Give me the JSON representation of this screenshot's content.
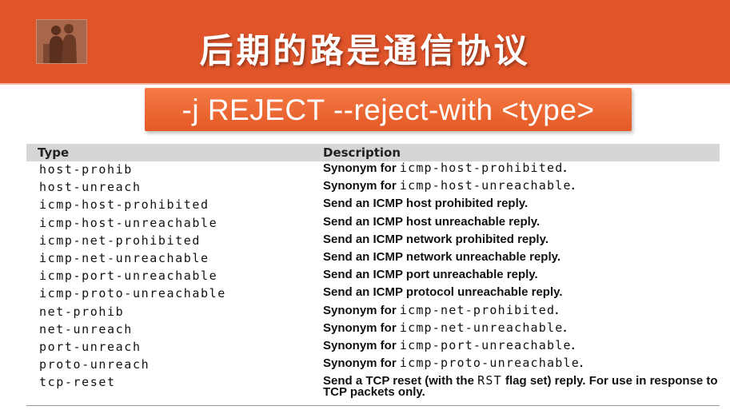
{
  "slide": {
    "title": "后期的路是通信协议",
    "command": "-j REJECT --reject-with <type>"
  },
  "table": {
    "headers": {
      "type": "Type",
      "description": "Description"
    },
    "rows": [
      {
        "type": "host-prohib",
        "desc_text": "Synonym for ",
        "desc_code": "icmp-host-prohibited",
        "desc_end": "."
      },
      {
        "type": "host-unreach",
        "desc_text": "Synonym for ",
        "desc_code": "icmp-host-unreachable",
        "desc_end": "."
      },
      {
        "type": "icmp-host-prohibited",
        "desc_text": "Send an ICMP host prohibited reply.",
        "desc_code": "",
        "desc_end": ""
      },
      {
        "type": "icmp-host-unreachable",
        "desc_text": "Send an ICMP host unreachable reply.",
        "desc_code": "",
        "desc_end": ""
      },
      {
        "type": "icmp-net-prohibited",
        "desc_text": "Send an ICMP network prohibited reply.",
        "desc_code": "",
        "desc_end": ""
      },
      {
        "type": "icmp-net-unreachable",
        "desc_text": "Send an ICMP network unreachable reply.",
        "desc_code": "",
        "desc_end": ""
      },
      {
        "type": "icmp-port-unreachable",
        "desc_text": "Send an ICMP port unreachable reply.",
        "desc_code": "",
        "desc_end": ""
      },
      {
        "type": "icmp-proto-unreachable",
        "desc_text": "Send an ICMP protocol unreachable reply.",
        "desc_code": "",
        "desc_end": ""
      },
      {
        "type": "net-prohib",
        "desc_text": "Synonym for ",
        "desc_code": "icmp-net-prohibited",
        "desc_end": "."
      },
      {
        "type": "net-unreach",
        "desc_text": "Synonym for ",
        "desc_code": "icmp-net-unreachable",
        "desc_end": "."
      },
      {
        "type": "port-unreach",
        "desc_text": "Synonym for ",
        "desc_code": "icmp-port-unreachable",
        "desc_end": "."
      },
      {
        "type": "proto-unreach",
        "desc_text": "Synonym for ",
        "desc_code": "icmp-proto-unreachable",
        "desc_end": "."
      }
    ],
    "last_row": {
      "type": "tcp-reset",
      "desc_before": "Send a TCP reset (with the ",
      "desc_code": "RST",
      "desc_after": " flag set) reply. For use in response to TCP packets only."
    }
  },
  "colors": {
    "banner": "#e0542a",
    "command_box": "#e55a26",
    "header_row": "#d6d6d6"
  },
  "icons": {
    "logo": "people-silhouette-photo"
  }
}
